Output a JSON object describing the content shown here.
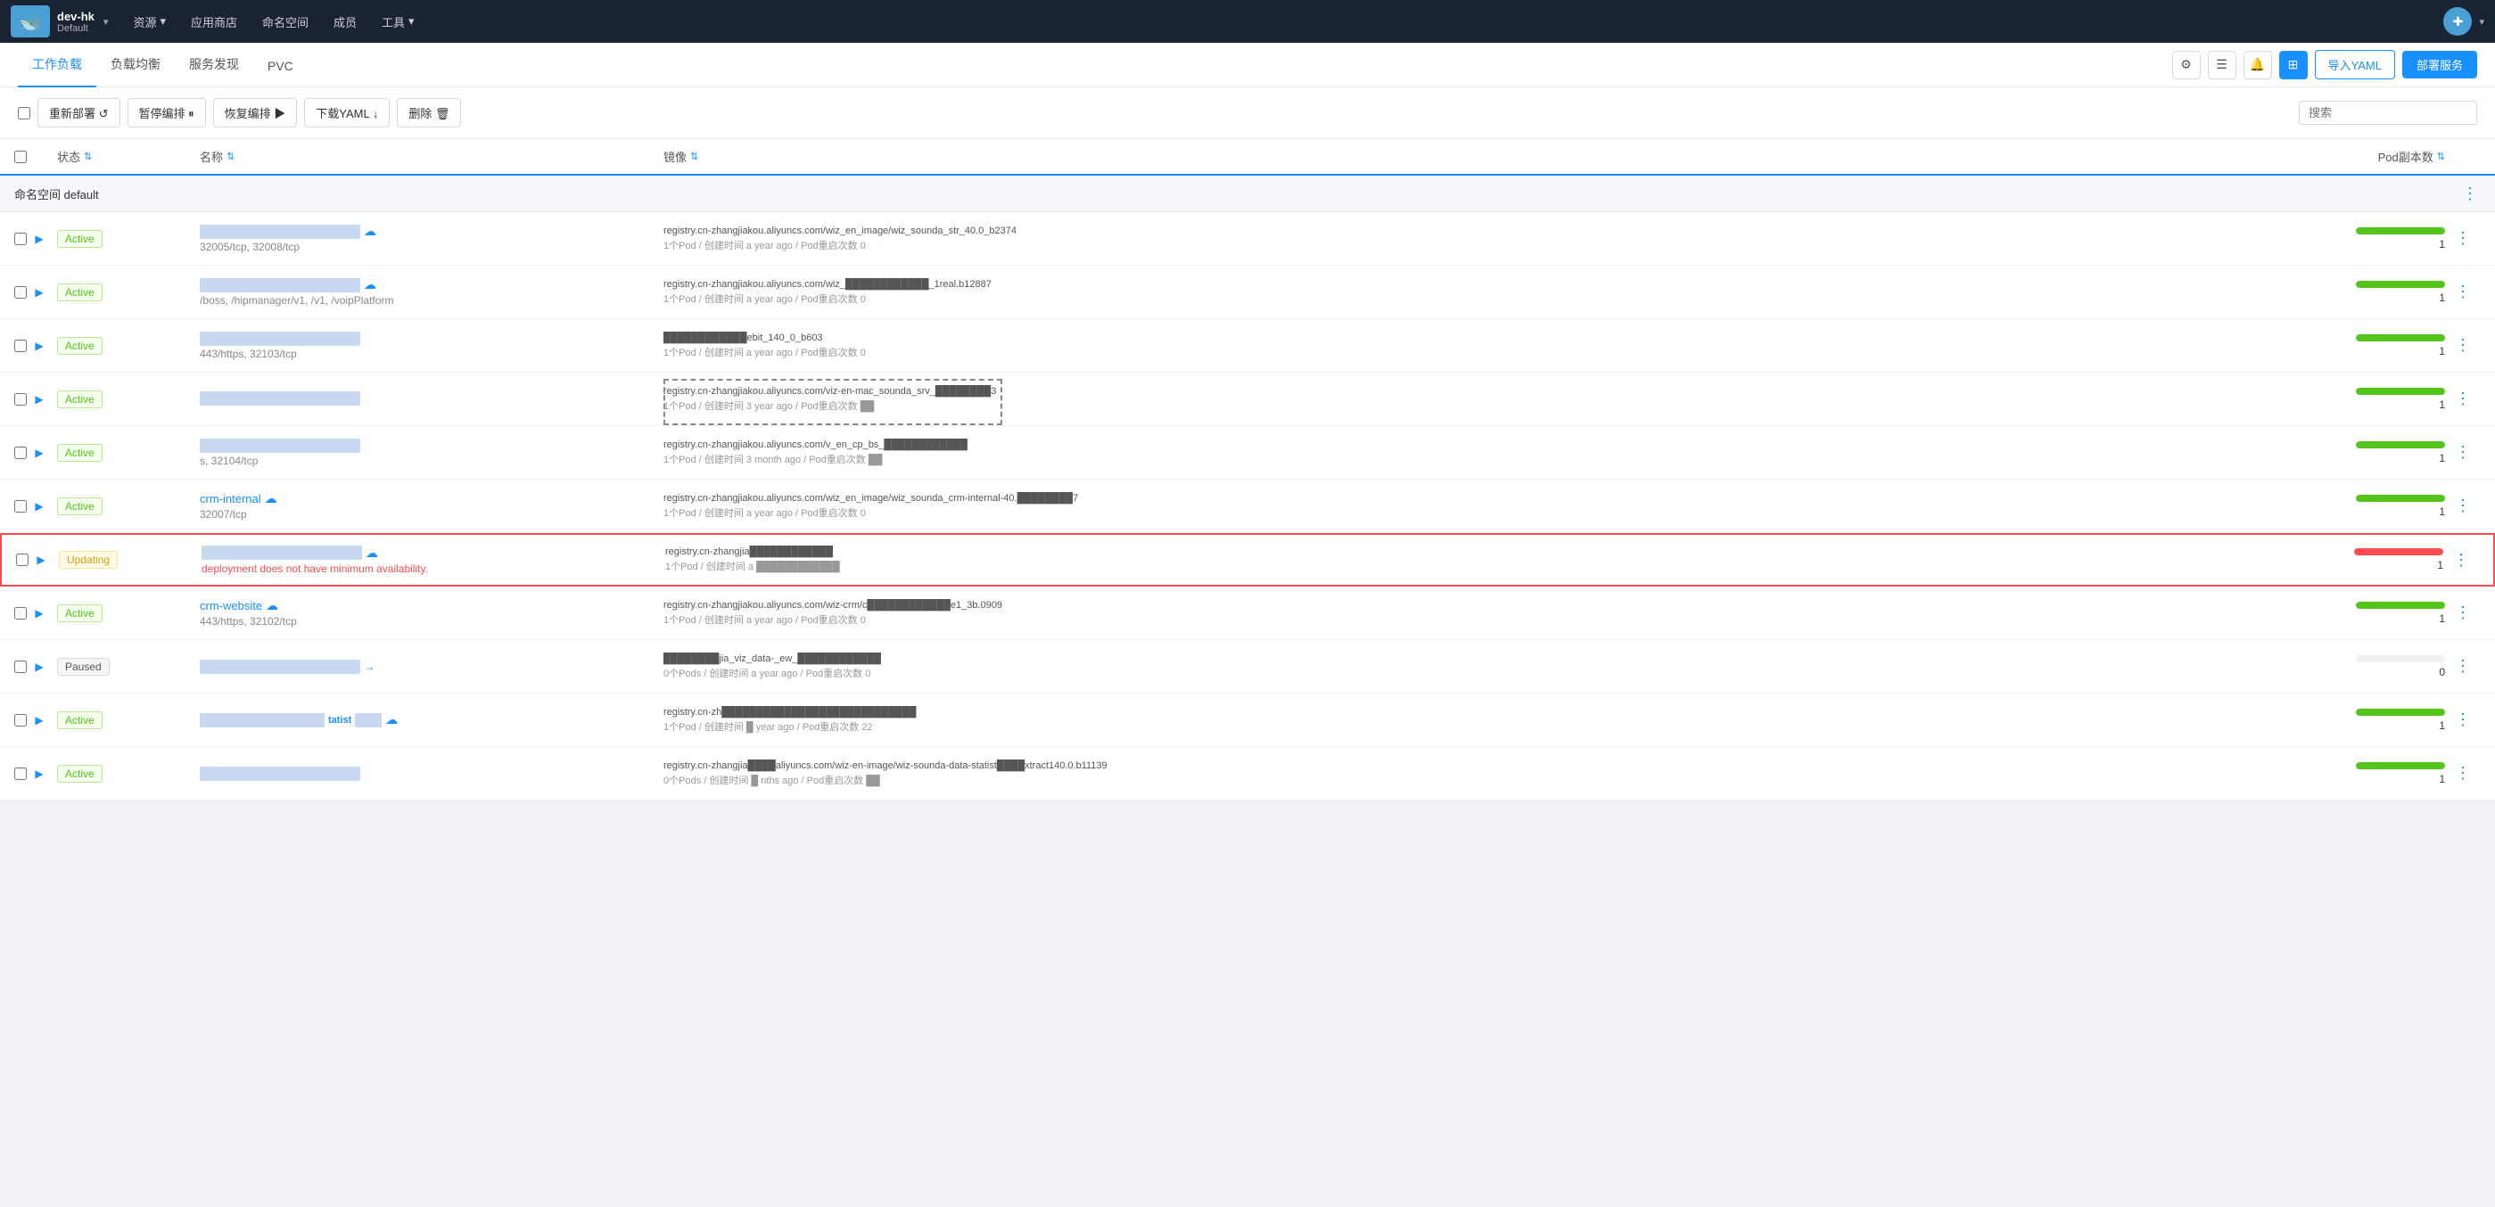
{
  "topNav": {
    "cluster": "dev-hk",
    "env": "Default",
    "logoIcon": "🐋",
    "menuItems": [
      "资源▾",
      "应用商店",
      "命名空间",
      "成员",
      "工具▾"
    ],
    "avatarIcon": "+"
  },
  "subNav": {
    "tabs": [
      "工作负载",
      "负载均衡",
      "服务发现",
      "PVC"
    ],
    "activeTab": "工作负载",
    "importLabel": "导入YAML",
    "deployLabel": "部署服务"
  },
  "toolbar": {
    "buttons": [
      "重新部署 ↺",
      "暂停编排 ⏸",
      "恢复编排 ▶",
      "下载YAML ↓",
      "删除 🗑"
    ],
    "searchPlaceholder": "搜索"
  },
  "tableHeader": {
    "cols": [
      "状态 ⇅",
      "名称 ⇅",
      "镜像 ⇅",
      "Pod副本数 ⇅"
    ]
  },
  "namespace": {
    "label": "命名空间",
    "name": "default"
  },
  "rows": [
    {
      "id": "row1",
      "status": "Active",
      "statusType": "active",
      "name": "████████████",
      "ports": "32005/tcp, 32008/tcp",
      "hasIcon": true,
      "iconType": "cloud",
      "image": "registry.cn-zhangjiakou.aliyuncs.com/wiz_en_image/wiz_sounda_str_40.0_b2374",
      "imageSub": "1个Pod / 创建时间 a year ago / Pod重启次数 0",
      "podCount": "1",
      "podBarType": "green"
    },
    {
      "id": "row2",
      "status": "Active",
      "statusType": "active",
      "name": "████████████",
      "ports": "/boss, /hipmanager/v1, /v1, /voipPlatform",
      "hasIcon": true,
      "iconType": "cloud",
      "image": "registry.cn-zhangjiakou.aliyuncs.com/wiz_████████████_1real.b12887",
      "imageSub": "1个Pod / 创建时间 a year ago / Pod重启次数 0",
      "podCount": "1",
      "podBarType": "green"
    },
    {
      "id": "row3",
      "status": "Active",
      "statusType": "active",
      "name": "████████████",
      "ports": "443/https, 32103/tcp",
      "hasIcon": false,
      "iconType": "",
      "image": "████████████ebit_140_0_b603",
      "imageSub": "1个Pod / 创建时间 a year ago / Pod重启次数 0",
      "podCount": "1",
      "podBarType": "green"
    },
    {
      "id": "row4",
      "status": "Active",
      "statusType": "active",
      "name": "████████████",
      "ports": "",
      "hasIcon": false,
      "iconType": "",
      "image": "registry.cn-zhangjiakou.aliyuncs.com/viz-en-mac_sounda_srv_████████████3",
      "imageSub": "1个Pod / 创建时间 3 year ago / Pod重启次数 ██",
      "podCount": "1",
      "podBarType": "green",
      "hasDashedOverlay": true
    },
    {
      "id": "row5",
      "status": "Active",
      "statusType": "active",
      "name": "████████████",
      "ports": "s, 32104/tcp",
      "hasIcon": false,
      "iconType": "",
      "image": "registry.cn-zhangjiakou.aliyuncs.com/v_en_cp_bs_████████████",
      "imageSub": "1个Pod / 创建时间 3 month ago / Pod重启次数 ██",
      "podCount": "1",
      "podBarType": "green",
      "hasDashedOverlay": true
    },
    {
      "id": "row6",
      "status": "Active",
      "statusType": "active",
      "name": "crm-internal",
      "ports": "32007/tcp",
      "hasIcon": true,
      "iconType": "cloud",
      "image": "registry.cn-zhangjiakou.aliyuncs.com/wiz_en_image/wiz_sounda_crm-internal-40.████████7",
      "imageSub": "1个Pod / 创建时间 a year ago / Pod重启次数 0",
      "podCount": "1",
      "podBarType": "green"
    },
    {
      "id": "row7",
      "status": "Updating",
      "statusType": "updating",
      "name": "████████████",
      "ports": "",
      "hasIcon": true,
      "iconType": "cloud",
      "errorText": "deployment does not have minimum availability.",
      "image": "registry.cn-zhangjia████████████",
      "imageSub": "1个Pod / 创建时间 a ████████████",
      "podCount": "1",
      "podBarType": "red",
      "isHighlighted": true
    },
    {
      "id": "row8",
      "status": "Active",
      "statusType": "active",
      "name": "crm-website",
      "ports": "443/https, 32102/tcp",
      "hasIcon": true,
      "iconType": "cloud",
      "image": "registry.cn-zhangjiakou.aliyuncs.com/wiz-crm/c████████████e1_3b.0909",
      "imageSub": "1个Pod / 创建时间 a year ago / Pod重启次数 0",
      "podCount": "1",
      "podBarType": "green"
    },
    {
      "id": "row9",
      "status": "Paused",
      "statusType": "paused",
      "name": "████████████",
      "ports": "",
      "hasIcon": true,
      "iconType": "arrow",
      "image": "████████jia_viz_data-_ew_████████████",
      "imageSub": "0个Pods / 创建时间 a year ago / Pod重启次数 0",
      "podCount": "0",
      "podBarType": "green"
    },
    {
      "id": "row10",
      "status": "Active",
      "statusType": "active",
      "name": "████tatist████",
      "ports": "",
      "hasIcon": true,
      "iconType": "cloud",
      "image": "registry.cn-zh████████████████████████████",
      "imageSub": "1个Pod / 创建时间 █ year ago / Pod重启次数 22",
      "podCount": "1",
      "podBarType": "green"
    },
    {
      "id": "row11",
      "status": "Active",
      "statusType": "active",
      "name": "████████████",
      "ports": "",
      "hasIcon": false,
      "iconType": "",
      "image": "registry.cn-zhangjia████aliyuncs.com/wiz-en-image/wiz-sounda-data-statist████xtract140.0.b11139",
      "imageSub": "0个Pods / 创建时间 █ nths ago / Pod重启次数 ██",
      "podCount": "1",
      "podBarType": "green"
    }
  ]
}
